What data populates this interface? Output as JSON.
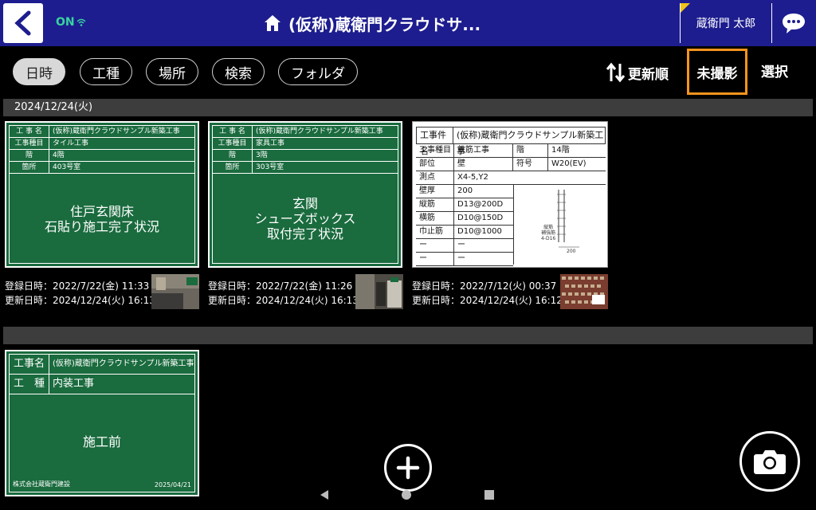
{
  "header": {
    "status": "ON",
    "title": "(仮称)蔵衛門クラウドサ...",
    "user": "蔵衛門 太郎",
    "icons": [
      "back-icon",
      "wifi-icon",
      "home-icon",
      "chat-icon"
    ]
  },
  "toolbar": {
    "filters": [
      "日時",
      "工種",
      "場所",
      "検索",
      "フォルダ"
    ],
    "sort_label": "更新順",
    "unshot_label": "未撮影",
    "select_label": "選択"
  },
  "groups": [
    {
      "date": "2024/12/24(火)",
      "cards": [
        {
          "board": {
            "rows": [
              {
                "key": "工 事 名",
                "val": "(仮称)蔵衛門クラウドサンプル新築工事"
              },
              {
                "key": "工事種目",
                "val": "タイル工事"
              },
              {
                "key": "階",
                "val": "4階"
              },
              {
                "key": "箇所",
                "val": "403号室"
              }
            ],
            "center": [
              "住戸玄関床",
              "石貼り施工完了状況"
            ]
          },
          "registered": "登録日時：2022/7/22(金) 11:33",
          "updated": "更新日時：2024/12/24(火) 16:13"
        },
        {
          "board": {
            "rows": [
              {
                "key": "工 事 名",
                "val": "(仮称)蔵衛門クラウドサンプル新築工事"
              },
              {
                "key": "工事種目",
                "val": "家具工事"
              },
              {
                "key": "階",
                "val": "3階"
              },
              {
                "key": "箇所",
                "val": "303号室"
              }
            ],
            "center": [
              "玄関",
              "シューズボックス",
              "取付完了状況"
            ]
          },
          "registered": "登録日時：2022/7/22(金) 11:26",
          "updated": "更新日時：2024/12/24(火) 16:13"
        },
        {
          "white_board": {
            "header_key": "工事件名",
            "header_val": "(仮称)蔵衛門クラウドサンプル新築工事",
            "rows": [
              {
                "key": "工事種目",
                "val": "鉄筋工事",
                "key2": "階",
                "val2": "14階"
              },
              {
                "key": "部位",
                "val": "壁",
                "key2": "符号",
                "val2": "W20(EV)"
              },
              {
                "key": "測点",
                "val": "X4-5,Y2"
              },
              {
                "key": "壁厚",
                "val": "200"
              },
              {
                "key": "縦筋",
                "val": "D13@200D"
              },
              {
                "key": "横筋",
                "val": "D10@150D"
              },
              {
                "key": "巾止筋",
                "val": "D10@1000"
              },
              {
                "key": "ー",
                "val": "ー"
              },
              {
                "key": "ー",
                "val": "ー"
              }
            ],
            "sketch_labels": [
              "縦筋",
              "補強筋",
              "4-D16",
              "200"
            ]
          },
          "registered": "登録日時：2022/7/12(火) 00:37",
          "updated": "更新日時：2024/12/24(火) 16:12"
        }
      ]
    },
    {
      "date": "",
      "cards": [
        {
          "board": {
            "rows": [
              {
                "key": "工事名",
                "val": "(仮称)蔵衛門クラウドサンプル新築工事"
              },
              {
                "key": "工　種",
                "val": "内装工事"
              }
            ],
            "center": [
              "施工前"
            ],
            "footer_left": "株式会社蔵衛門建設",
            "footer_right": "2025/04/21"
          }
        }
      ]
    }
  ],
  "colors": {
    "header_bg": "#1d1d8f",
    "board_green": "#1a6b3e",
    "highlight": "#f7941d",
    "status_green": "#38d39f"
  }
}
